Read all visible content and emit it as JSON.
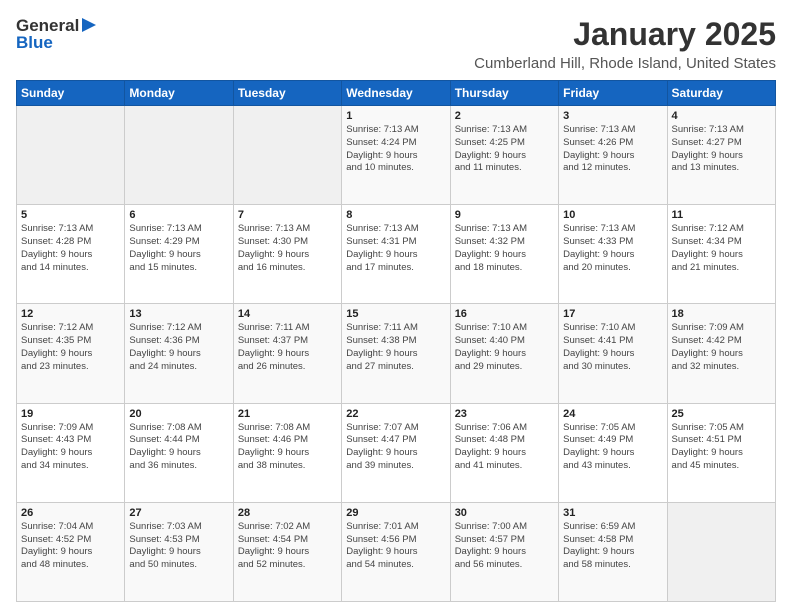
{
  "header": {
    "logo_line1": "General",
    "logo_line2": "Blue",
    "title": "January 2025",
    "subtitle": "Cumberland Hill, Rhode Island, United States"
  },
  "columns": [
    "Sunday",
    "Monday",
    "Tuesday",
    "Wednesday",
    "Thursday",
    "Friday",
    "Saturday"
  ],
  "weeks": [
    [
      {
        "day": "",
        "info": ""
      },
      {
        "day": "",
        "info": ""
      },
      {
        "day": "",
        "info": ""
      },
      {
        "day": "1",
        "info": "Sunrise: 7:13 AM\nSunset: 4:24 PM\nDaylight: 9 hours\nand 10 minutes."
      },
      {
        "day": "2",
        "info": "Sunrise: 7:13 AM\nSunset: 4:25 PM\nDaylight: 9 hours\nand 11 minutes."
      },
      {
        "day": "3",
        "info": "Sunrise: 7:13 AM\nSunset: 4:26 PM\nDaylight: 9 hours\nand 12 minutes."
      },
      {
        "day": "4",
        "info": "Sunrise: 7:13 AM\nSunset: 4:27 PM\nDaylight: 9 hours\nand 13 minutes."
      }
    ],
    [
      {
        "day": "5",
        "info": "Sunrise: 7:13 AM\nSunset: 4:28 PM\nDaylight: 9 hours\nand 14 minutes."
      },
      {
        "day": "6",
        "info": "Sunrise: 7:13 AM\nSunset: 4:29 PM\nDaylight: 9 hours\nand 15 minutes."
      },
      {
        "day": "7",
        "info": "Sunrise: 7:13 AM\nSunset: 4:30 PM\nDaylight: 9 hours\nand 16 minutes."
      },
      {
        "day": "8",
        "info": "Sunrise: 7:13 AM\nSunset: 4:31 PM\nDaylight: 9 hours\nand 17 minutes."
      },
      {
        "day": "9",
        "info": "Sunrise: 7:13 AM\nSunset: 4:32 PM\nDaylight: 9 hours\nand 18 minutes."
      },
      {
        "day": "10",
        "info": "Sunrise: 7:13 AM\nSunset: 4:33 PM\nDaylight: 9 hours\nand 20 minutes."
      },
      {
        "day": "11",
        "info": "Sunrise: 7:12 AM\nSunset: 4:34 PM\nDaylight: 9 hours\nand 21 minutes."
      }
    ],
    [
      {
        "day": "12",
        "info": "Sunrise: 7:12 AM\nSunset: 4:35 PM\nDaylight: 9 hours\nand 23 minutes."
      },
      {
        "day": "13",
        "info": "Sunrise: 7:12 AM\nSunset: 4:36 PM\nDaylight: 9 hours\nand 24 minutes."
      },
      {
        "day": "14",
        "info": "Sunrise: 7:11 AM\nSunset: 4:37 PM\nDaylight: 9 hours\nand 26 minutes."
      },
      {
        "day": "15",
        "info": "Sunrise: 7:11 AM\nSunset: 4:38 PM\nDaylight: 9 hours\nand 27 minutes."
      },
      {
        "day": "16",
        "info": "Sunrise: 7:10 AM\nSunset: 4:40 PM\nDaylight: 9 hours\nand 29 minutes."
      },
      {
        "day": "17",
        "info": "Sunrise: 7:10 AM\nSunset: 4:41 PM\nDaylight: 9 hours\nand 30 minutes."
      },
      {
        "day": "18",
        "info": "Sunrise: 7:09 AM\nSunset: 4:42 PM\nDaylight: 9 hours\nand 32 minutes."
      }
    ],
    [
      {
        "day": "19",
        "info": "Sunrise: 7:09 AM\nSunset: 4:43 PM\nDaylight: 9 hours\nand 34 minutes."
      },
      {
        "day": "20",
        "info": "Sunrise: 7:08 AM\nSunset: 4:44 PM\nDaylight: 9 hours\nand 36 minutes."
      },
      {
        "day": "21",
        "info": "Sunrise: 7:08 AM\nSunset: 4:46 PM\nDaylight: 9 hours\nand 38 minutes."
      },
      {
        "day": "22",
        "info": "Sunrise: 7:07 AM\nSunset: 4:47 PM\nDaylight: 9 hours\nand 39 minutes."
      },
      {
        "day": "23",
        "info": "Sunrise: 7:06 AM\nSunset: 4:48 PM\nDaylight: 9 hours\nand 41 minutes."
      },
      {
        "day": "24",
        "info": "Sunrise: 7:05 AM\nSunset: 4:49 PM\nDaylight: 9 hours\nand 43 minutes."
      },
      {
        "day": "25",
        "info": "Sunrise: 7:05 AM\nSunset: 4:51 PM\nDaylight: 9 hours\nand 45 minutes."
      }
    ],
    [
      {
        "day": "26",
        "info": "Sunrise: 7:04 AM\nSunset: 4:52 PM\nDaylight: 9 hours\nand 48 minutes."
      },
      {
        "day": "27",
        "info": "Sunrise: 7:03 AM\nSunset: 4:53 PM\nDaylight: 9 hours\nand 50 minutes."
      },
      {
        "day": "28",
        "info": "Sunrise: 7:02 AM\nSunset: 4:54 PM\nDaylight: 9 hours\nand 52 minutes."
      },
      {
        "day": "29",
        "info": "Sunrise: 7:01 AM\nSunset: 4:56 PM\nDaylight: 9 hours\nand 54 minutes."
      },
      {
        "day": "30",
        "info": "Sunrise: 7:00 AM\nSunset: 4:57 PM\nDaylight: 9 hours\nand 56 minutes."
      },
      {
        "day": "31",
        "info": "Sunrise: 6:59 AM\nSunset: 4:58 PM\nDaylight: 9 hours\nand 58 minutes."
      },
      {
        "day": "",
        "info": ""
      }
    ]
  ]
}
